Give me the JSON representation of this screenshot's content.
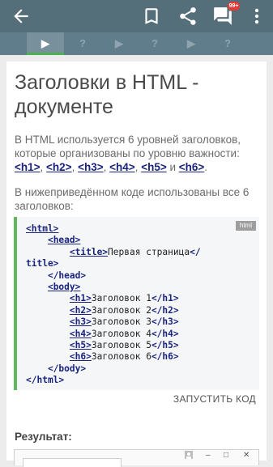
{
  "appbar": {
    "back_icon": "arrow-back-icon",
    "bookmark_icon": "bookmark-icon",
    "share_icon": "share-icon",
    "comments_icon": "comments-icon",
    "comments_badge": "99+",
    "more_icon": "more-vert-icon"
  },
  "progress": {
    "steps": [
      {
        "mark": "▶",
        "state": "current"
      },
      {
        "mark": "?",
        "state": "quiz"
      },
      {
        "mark": "▶",
        "state": "lesson"
      },
      {
        "mark": "?",
        "state": "quiz"
      },
      {
        "mark": "▶",
        "state": "lesson"
      },
      {
        "mark": "?",
        "state": "quiz"
      }
    ],
    "accent": "#4caf50"
  },
  "lesson": {
    "title": "Заголовки в HTML - документе",
    "p1_text": "В HTML используется 6 уровней заголовков, которые организованы по уровню важности:",
    "p1_tags": [
      "<h1>",
      "<h2>",
      "<h3>",
      "<h4>",
      "<h5>",
      "<h6>"
    ],
    "p1_sep": ", ",
    "p1_and": " и ",
    "p1_end": ".",
    "p2_text": "В нижеприведённом коде использованы все 6 заголовков:",
    "code_lang": "html",
    "code": {
      "html_open": "<html>",
      "head_open": "<head>",
      "title_open": "<title>",
      "title_text": "Первая страница",
      "title_close": "</",
      "title_close2": "title>",
      "head_close": "</head>",
      "body_open": "<body>",
      "headings": [
        {
          "open": "<h1>",
          "text": "Заголовок 1",
          "close": "</h1>"
        },
        {
          "open": "<h2>",
          "text": "Заголовок 2",
          "close": "</h2>"
        },
        {
          "open": "<h3>",
          "text": "Заголовок 3",
          "close": "</h3>"
        },
        {
          "open": "<h4>",
          "text": "Заголовок 4",
          "close": "</h4>"
        },
        {
          "open": "<h5>",
          "text": "Заголовок 5",
          "close": "</h5>"
        },
        {
          "open": "<h6>",
          "text": "Заголовок 6",
          "close": "</h6>"
        }
      ],
      "body_close": "</body>",
      "html_close": "</html>"
    },
    "run_button": "ЗАПУСТИТЬ КОД",
    "result_label": "Результат:",
    "result_window_controls": [
      "–",
      "□",
      "✕"
    ]
  }
}
